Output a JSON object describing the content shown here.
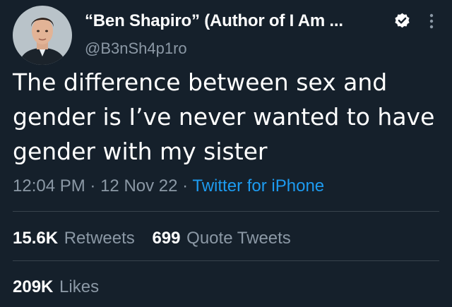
{
  "author": {
    "display_name": "“Ben Shapiro” (Author of I Am ...",
    "handle": "@B3nSh4p1ro",
    "verified_icon": "verified-badge-icon"
  },
  "tweet": {
    "text": "The difference between sex and gender is I’ve never wanted to have gender with my sister"
  },
  "meta": {
    "time": "12:04 PM",
    "separator": "·",
    "date": "12 Nov 22",
    "source": "Twitter for iPhone"
  },
  "stats": {
    "retweets_count": "15.6K",
    "retweets_label": "Retweets",
    "quotes_count": "699",
    "quotes_label": "Quote Tweets",
    "likes_count": "209K",
    "likes_label": "Likes"
  },
  "colors": {
    "background": "#15202b",
    "text": "#ffffff",
    "secondary": "#8b98a5",
    "link": "#1d9bf0",
    "divider": "#38444d"
  }
}
